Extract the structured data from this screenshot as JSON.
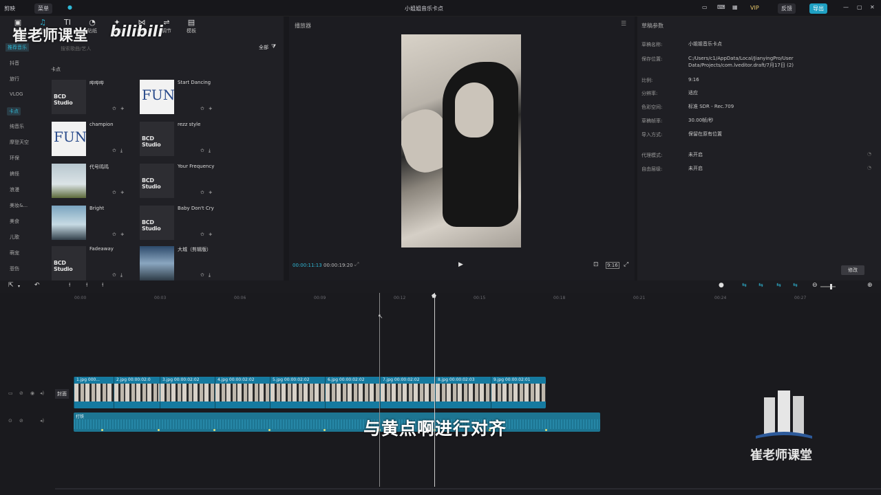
{
  "app": {
    "name": "剪映",
    "menu": "菜单",
    "title": "小姐姐音乐卡点",
    "vip_badge": "VIP",
    "btn_feedback": "反馈",
    "btn_export": "导出"
  },
  "tools": [
    "媒体",
    "音频",
    "文本",
    "贴纸",
    "特效",
    "转场",
    "调节",
    "模板"
  ],
  "categories": [
    "推荐音乐",
    "抖音",
    "旅行",
    "VLOG",
    "卡点",
    "纯音乐",
    "摩登天空",
    "环保",
    "搞怪",
    "浪漫",
    "美妆&...",
    "美食",
    "儿歌",
    "萌宠",
    "悲伤"
  ],
  "media": {
    "filter_all": "全部",
    "section": "卡点",
    "search_placeholder": "搜索歌曲/艺人",
    "cards": [
      {
        "title": "哔哔哔",
        "thumb": "bcd",
        "icons": [
          "star-icon",
          "plus-icon"
        ]
      },
      {
        "title": "Start Dancing",
        "thumb": "fun",
        "icons": [
          "star-icon",
          "plus-icon"
        ]
      },
      {
        "title": "champion",
        "thumb": "fun",
        "icons": [
          "star-icon",
          "download-icon"
        ]
      },
      {
        "title": "rezz style",
        "thumb": "bcd",
        "icons": [
          "star-icon",
          "download-icon"
        ]
      },
      {
        "title": "代号鸣鸣",
        "thumb": "img1",
        "icons": [
          "star-icon",
          "plus-icon"
        ]
      },
      {
        "title": "Your Frequency",
        "thumb": "bcd",
        "icons": [
          "star-icon",
          "plus-icon"
        ]
      },
      {
        "title": "Bright",
        "thumb": "img2",
        "icons": [
          "star-icon",
          "plus-icon"
        ]
      },
      {
        "title": "Baby Don't Cry",
        "thumb": "bcd",
        "icons": [
          "star-icon",
          "plus-icon"
        ]
      },
      {
        "title": "Fadeaway",
        "thumb": "bcd",
        "icons": [
          "star-icon",
          "download-icon"
        ]
      },
      {
        "title": "大城（剪辑版）",
        "thumb": "img3",
        "icons": [
          "star-icon",
          "download-icon"
        ]
      }
    ]
  },
  "player": {
    "label": "播放器",
    "time_current": "00:00:11:13",
    "time_total": "00:00:19:20",
    "ratio_btn": "9:16"
  },
  "props": {
    "header": "草稿参数",
    "rows": [
      {
        "label": "草稿名称:",
        "value": "小姐姐音乐卡点"
      },
      {
        "label": "保存位置:",
        "value": "C:/Users/c1/AppData/Local/JianyingPro/User Data/Projects/com.lveditor.draft/7月17日 (2)"
      },
      {
        "label": "比例:",
        "value": "9:16"
      },
      {
        "label": "分辨率:",
        "value": "适应"
      },
      {
        "label": "色彩空间:",
        "value": "标准 SDR - Rec.709"
      },
      {
        "label": "草稿帧率:",
        "value": "30.00帧/秒"
      },
      {
        "label": "导入方式:",
        "value": "保留在原有位置"
      },
      {
        "label": "代理模式:",
        "value": "未开启"
      },
      {
        "label": "自由层级:",
        "value": "未开启"
      }
    ],
    "modify_btn": "修改"
  },
  "timeline": {
    "ticks": [
      "00:00",
      "00:03",
      "00:06",
      "00:09",
      "00:12",
      "00:15",
      "00:18",
      "00:21",
      "00:24",
      "00:27"
    ],
    "cover_label": "封面",
    "clips": [
      "1.jpg  000...",
      "2.jpg  00:00:02:0",
      "3.jpg  00:00:02:02",
      "4.jpg  00:00:02:02",
      "5.jpg  00:00:02:02",
      "6.jpg  00:00:02:02",
      "7.jpg  00:00:02:02",
      "8.jpg  00:00:02:03",
      "9.jpg  00:00:02:01"
    ],
    "audio_label": "打铁",
    "subtitle": "与黄点啊进行对齐"
  },
  "watermark": {
    "top_left": "崔老师课堂",
    "bili": "bilibili",
    "bottom_right": "崔老师课堂"
  }
}
